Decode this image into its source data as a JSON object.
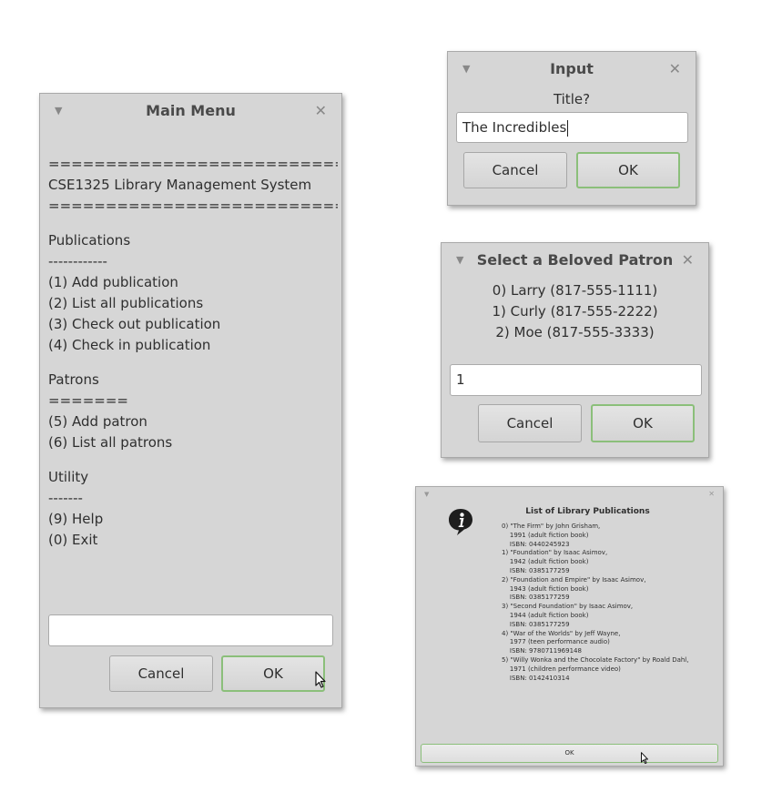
{
  "main_menu": {
    "title": "Main Menu",
    "lines": [
      "==================================",
      "CSE1325 Library Management System",
      "==================================",
      "",
      "Publications",
      "------------",
      "(1) Add publication",
      "(2) List all publications",
      "(3) Check out publication",
      "(4) Check in publication",
      "",
      "Patrons",
      "=======",
      "(5) Add patron",
      "(6) List all patrons",
      "",
      "Utility",
      "-------",
      "(9) Help",
      "(0) Exit"
    ],
    "input_value": "",
    "cancel_label": "Cancel",
    "ok_label": "OK"
  },
  "input_dialog": {
    "title": "Input",
    "prompt": "Title?",
    "input_value": "The Incredibles",
    "cancel_label": "Cancel",
    "ok_label": "OK"
  },
  "patron_dialog": {
    "title": "Select a Beloved Patron",
    "patrons": [
      "0) Larry (817-555-1111)",
      "1) Curly (817-555-2222)",
      "2) Moe (817-555-3333)"
    ],
    "input_value": "1",
    "cancel_label": "Cancel",
    "ok_label": "OK"
  },
  "publications_dialog": {
    "heading": "List of Library Publications",
    "entries": [
      "0) \"The Firm\" by John Grisham,",
      "    1991 (adult fiction book)",
      "    ISBN: 0440245923",
      "1) \"Foundation\" by Isaac Asimov,",
      "    1942 (adult fiction book)",
      "    ISBN: 0385177259",
      "2) \"Foundation and Empire\" by Isaac Asimov,",
      "    1943 (adult fiction book)",
      "    ISBN: 0385177259",
      "3) \"Second Foundation\" by Isaac Asimov,",
      "    1944 (adult fiction book)",
      "    ISBN: 0385177259",
      "4) \"War of the Worlds\" by Jeff Wayne,",
      "    1977 (teen performance audio)",
      "    ISBN: 9780711969148",
      "5) \"Willy Wonka and the Chocolate Factory\" by Roald Dahl,",
      "    1971 (children performance video)",
      "    ISBN: 0142410314"
    ],
    "ok_label": "OK"
  }
}
